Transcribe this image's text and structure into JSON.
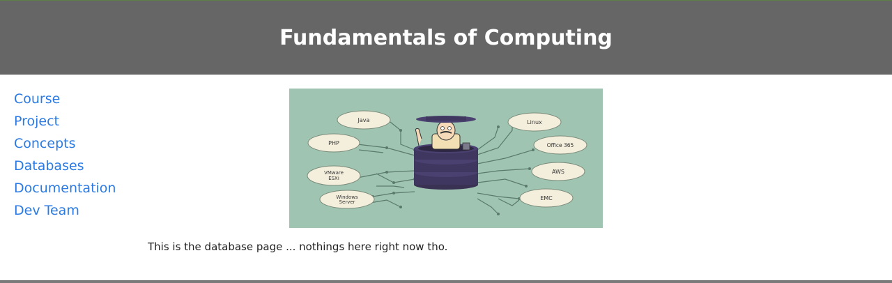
{
  "header": {
    "title": "Fundamentals of Computing"
  },
  "nav": {
    "items": [
      {
        "label": "Course"
      },
      {
        "label": "Project"
      },
      {
        "label": "Concepts"
      },
      {
        "label": "Databases"
      },
      {
        "label": "Documentation"
      },
      {
        "label": "Dev Team"
      }
    ]
  },
  "illustration": {
    "labels": {
      "java": "Java",
      "php": "PHP",
      "vmware_line1": "VMware",
      "vmware_line2": "ESXi",
      "windows_line1": "Windows",
      "windows_line2": "Server",
      "linux": "Linux",
      "office": "Office 365",
      "aws": "AWS",
      "emc": "EMC"
    }
  },
  "main": {
    "text": "This is the database page ... nothings here right now tho."
  },
  "colors": {
    "header_bg": "#666666",
    "link": "#2a7ae2",
    "illustration_bg": "#9fc5b2"
  }
}
